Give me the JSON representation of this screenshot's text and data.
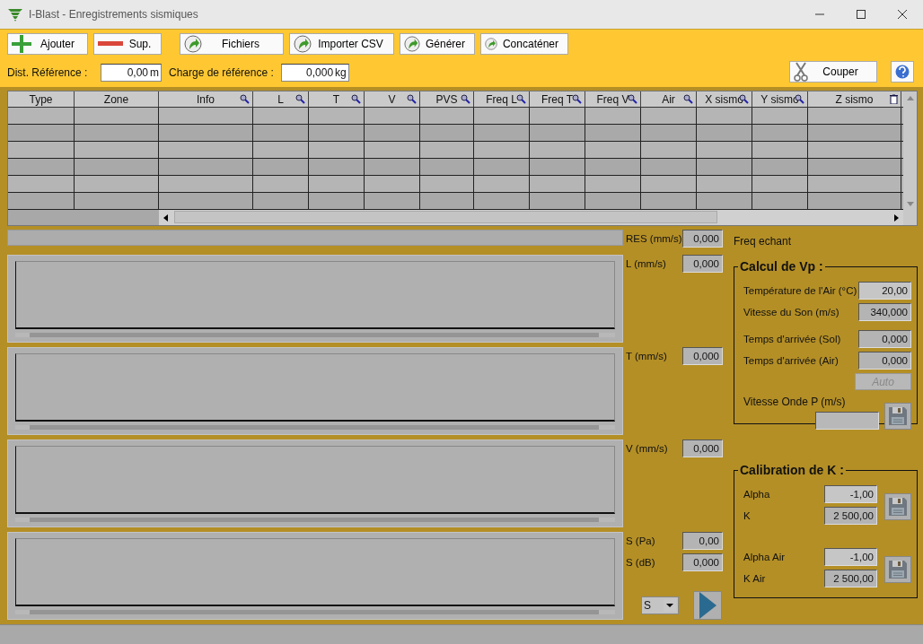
{
  "window": {
    "title": "I-Blast - Enregistrements sismiques"
  },
  "toolbar": {
    "buttons": [
      {
        "label": "Ajouter",
        "kind": "add"
      },
      {
        "label": "Sup.",
        "kind": "remove"
      },
      {
        "label": "Fichiers",
        "kind": "action"
      },
      {
        "label": "Importer CSV",
        "kind": "action"
      },
      {
        "label": "Générer",
        "kind": "action"
      },
      {
        "label": "Concaténer",
        "kind": "action"
      }
    ],
    "fields": [
      {
        "label": "Dist. Référence :",
        "value": "0,00",
        "unit": "m"
      },
      {
        "label": "Charge de référence :",
        "value": "0,000",
        "unit": "kg"
      }
    ],
    "cut_button": "Couper"
  },
  "table": {
    "columns": [
      {
        "label": "Type",
        "filter": false
      },
      {
        "label": "Zone",
        "filter": false
      },
      {
        "label": "Info",
        "filter": true
      },
      {
        "label": "L",
        "filter": true
      },
      {
        "label": "T",
        "filter": true
      },
      {
        "label": "V",
        "filter": true
      },
      {
        "label": "PVS",
        "filter": true
      },
      {
        "label": "Freq L",
        "filter": true
      },
      {
        "label": "Freq T",
        "filter": true
      },
      {
        "label": "Freq V",
        "filter": true
      },
      {
        "label": "Air",
        "filter": true
      },
      {
        "label": "X sismo",
        "filter": true
      },
      {
        "label": "Y sismo",
        "filter": true
      },
      {
        "label": "Z sismo",
        "filter": false
      }
    ]
  },
  "res_reading": {
    "label": "RES (mm/s)",
    "value": "0,000"
  },
  "panels": [
    {
      "readings": [
        {
          "label": "L (mm/s)",
          "value": "0,000"
        }
      ]
    },
    {
      "readings": [
        {
          "label": "T (mm/s)",
          "value": "0,000"
        }
      ]
    },
    {
      "readings": [
        {
          "label": "V (mm/s)",
          "value": "0,000"
        }
      ]
    },
    {
      "readings": [
        {
          "label": "S (Pa)",
          "value": "0,00"
        },
        {
          "label": "S (dB)",
          "value": "0,000"
        }
      ]
    }
  ],
  "channel_select": "S",
  "freq_label": "Freq echant",
  "vp_group": {
    "title": "Calcul de Vp :",
    "fields": [
      {
        "label": "Température de l'Air (°C)",
        "value": "20,00",
        "editable": true
      },
      {
        "label": "Vitesse du Son (m/s)",
        "value": "340,000",
        "editable": false
      },
      {
        "label": "Temps d'arrivée (Sol)",
        "value": "0,000",
        "editable": false
      },
      {
        "label": "Temps d'arrivée (Air)",
        "value": "0,000",
        "editable": false
      }
    ],
    "auto_button": {
      "label": "Auto",
      "disabled": true
    },
    "wave_label": "Vitesse Onde P (m/s)"
  },
  "k_group": {
    "title": "Calibration de K :",
    "sets": [
      {
        "fields": [
          {
            "label": "Alpha",
            "value": "-1,00",
            "editable": true
          },
          {
            "label": "K",
            "value": "2 500,00",
            "editable": false
          }
        ]
      },
      {
        "fields": [
          {
            "label": "Alpha Air",
            "value": "-1,00",
            "editable": true
          },
          {
            "label": "K Air",
            "value": "2 500,00",
            "editable": false
          }
        ]
      }
    ]
  }
}
